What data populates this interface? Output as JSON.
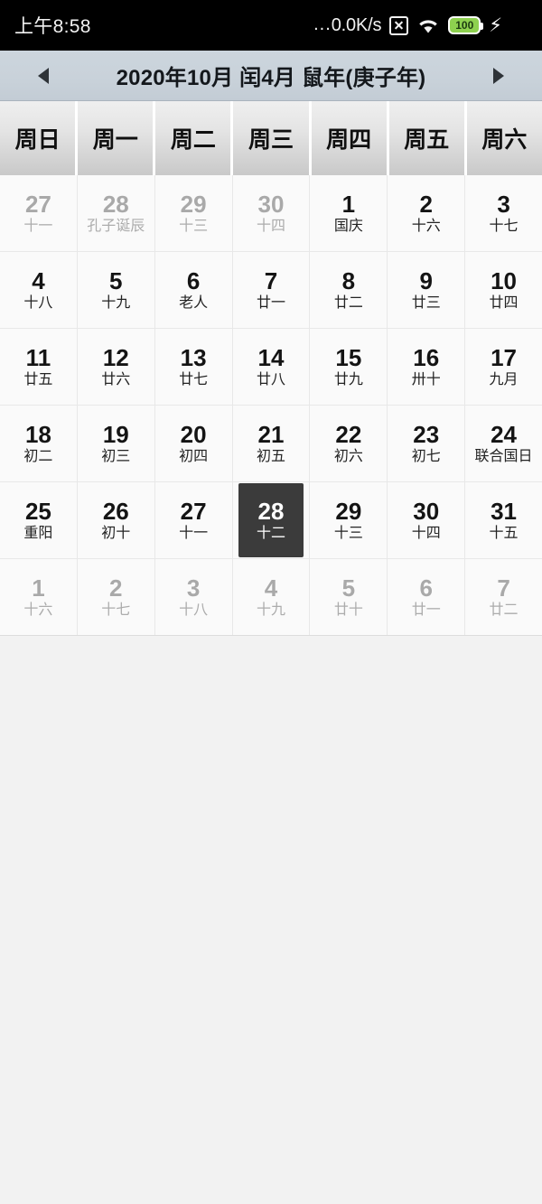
{
  "status_bar": {
    "clock": "上午8:58",
    "net_dots": "...",
    "net_speed": "0.0K/s",
    "no_sim_icon": "no-sim-icon",
    "wifi_icon": "wifi-icon",
    "battery_level": "100",
    "charging_icon": "⚡"
  },
  "header": {
    "prev_label": "◀",
    "next_label": "▶",
    "title": "2020年10月 闰4月 鼠年(庚子年)",
    "solar_year": "2020年",
    "solar_month": "10月",
    "leap_month": "闰4月",
    "zodiac_year": "鼠年(庚子年)"
  },
  "weekdays": [
    "周日",
    "周一",
    "周二",
    "周三",
    "周四",
    "周五",
    "周六"
  ],
  "colors": {
    "status_bar_bg": "#000000",
    "header_bg": "#ccd5dd",
    "weekday_bg": "#e4e4e4",
    "cell_bg": "#fafafa",
    "selected_bg": "#3b3b3b",
    "battery_green": "#8ed14f",
    "other_month_text": "#a9a9a9"
  },
  "days": [
    {
      "num": "27",
      "lunar": "十一",
      "other": true,
      "selected": false
    },
    {
      "num": "28",
      "lunar": "孔子诞辰",
      "other": true,
      "selected": false
    },
    {
      "num": "29",
      "lunar": "十三",
      "other": true,
      "selected": false
    },
    {
      "num": "30",
      "lunar": "十四",
      "other": true,
      "selected": false
    },
    {
      "num": "1",
      "lunar": "国庆",
      "other": false,
      "selected": false
    },
    {
      "num": "2",
      "lunar": "十六",
      "other": false,
      "selected": false
    },
    {
      "num": "3",
      "lunar": "十七",
      "other": false,
      "selected": false
    },
    {
      "num": "4",
      "lunar": "十八",
      "other": false,
      "selected": false
    },
    {
      "num": "5",
      "lunar": "十九",
      "other": false,
      "selected": false
    },
    {
      "num": "6",
      "lunar": "老人",
      "other": false,
      "selected": false
    },
    {
      "num": "7",
      "lunar": "廿一",
      "other": false,
      "selected": false
    },
    {
      "num": "8",
      "lunar": "廿二",
      "other": false,
      "selected": false
    },
    {
      "num": "9",
      "lunar": "廿三",
      "other": false,
      "selected": false
    },
    {
      "num": "10",
      "lunar": "廿四",
      "other": false,
      "selected": false
    },
    {
      "num": "11",
      "lunar": "廿五",
      "other": false,
      "selected": false
    },
    {
      "num": "12",
      "lunar": "廿六",
      "other": false,
      "selected": false
    },
    {
      "num": "13",
      "lunar": "廿七",
      "other": false,
      "selected": false
    },
    {
      "num": "14",
      "lunar": "廿八",
      "other": false,
      "selected": false
    },
    {
      "num": "15",
      "lunar": "廿九",
      "other": false,
      "selected": false
    },
    {
      "num": "16",
      "lunar": "卅十",
      "other": false,
      "selected": false
    },
    {
      "num": "17",
      "lunar": "九月",
      "other": false,
      "selected": false
    },
    {
      "num": "18",
      "lunar": "初二",
      "other": false,
      "selected": false
    },
    {
      "num": "19",
      "lunar": "初三",
      "other": false,
      "selected": false
    },
    {
      "num": "20",
      "lunar": "初四",
      "other": false,
      "selected": false
    },
    {
      "num": "21",
      "lunar": "初五",
      "other": false,
      "selected": false
    },
    {
      "num": "22",
      "lunar": "初六",
      "other": false,
      "selected": false
    },
    {
      "num": "23",
      "lunar": "初七",
      "other": false,
      "selected": false
    },
    {
      "num": "24",
      "lunar": "联合国日",
      "other": false,
      "selected": false
    },
    {
      "num": "25",
      "lunar": "重阳",
      "other": false,
      "selected": false
    },
    {
      "num": "26",
      "lunar": "初十",
      "other": false,
      "selected": false
    },
    {
      "num": "27",
      "lunar": "十一",
      "other": false,
      "selected": false
    },
    {
      "num": "28",
      "lunar": "十二",
      "other": false,
      "selected": true
    },
    {
      "num": "29",
      "lunar": "十三",
      "other": false,
      "selected": false
    },
    {
      "num": "30",
      "lunar": "十四",
      "other": false,
      "selected": false
    },
    {
      "num": "31",
      "lunar": "十五",
      "other": false,
      "selected": false
    },
    {
      "num": "1",
      "lunar": "十六",
      "other": true,
      "selected": false
    },
    {
      "num": "2",
      "lunar": "十七",
      "other": true,
      "selected": false
    },
    {
      "num": "3",
      "lunar": "十八",
      "other": true,
      "selected": false
    },
    {
      "num": "4",
      "lunar": "十九",
      "other": true,
      "selected": false
    },
    {
      "num": "5",
      "lunar": "廿十",
      "other": true,
      "selected": false
    },
    {
      "num": "6",
      "lunar": "廿一",
      "other": true,
      "selected": false
    },
    {
      "num": "7",
      "lunar": "廿二",
      "other": true,
      "selected": false
    }
  ]
}
